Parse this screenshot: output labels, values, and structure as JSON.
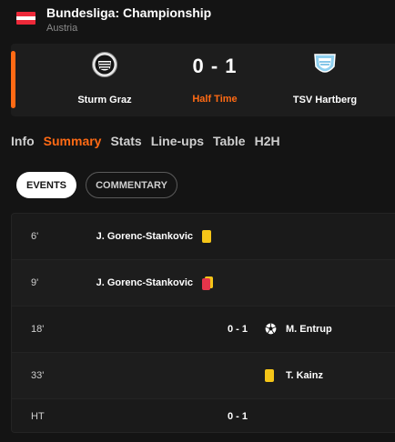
{
  "header": {
    "league": "Bundesliga: Championship",
    "country": "Austria",
    "flag_colors": [
      "#ed2939",
      "#ffffff",
      "#ed2939"
    ]
  },
  "match": {
    "home_team": "Sturm Graz",
    "away_team": "TSV Hartberg",
    "score": "0 - 1",
    "status": "Half Time",
    "home_crest_icon": "sturm-graz-crest-icon",
    "away_crest_icon": "tsv-hartberg-crest-icon"
  },
  "tabs": [
    {
      "label": "Info",
      "active": false
    },
    {
      "label": "Summary",
      "active": true
    },
    {
      "label": "Stats",
      "active": false
    },
    {
      "label": "Line-ups",
      "active": false
    },
    {
      "label": "Table",
      "active": false
    },
    {
      "label": "H2H",
      "active": false
    }
  ],
  "segments": {
    "events": "EVENTS",
    "commentary": "COMMENTARY",
    "selected": "events"
  },
  "events": [
    {
      "minute": "6'",
      "home_player": "J. Gorenc-Stankovic",
      "home_icon": "yellow-card-icon"
    },
    {
      "minute": "9'",
      "home_player": "J. Gorenc-Stankovic",
      "home_icon": "second-yellow-card-icon"
    },
    {
      "minute": "18'",
      "score": "0 - 1",
      "away_icon": "goal-ball-icon",
      "away_player": "M. Entrup"
    },
    {
      "minute": "33'",
      "away_icon": "yellow-card-icon",
      "away_player": "T. Kainz"
    },
    {
      "minute": "HT",
      "score": "0 - 1"
    }
  ],
  "colors": {
    "accent": "#ff6a14",
    "background": "#141414",
    "card_yellow": "#f5c518",
    "card_red": "#e5354a"
  }
}
